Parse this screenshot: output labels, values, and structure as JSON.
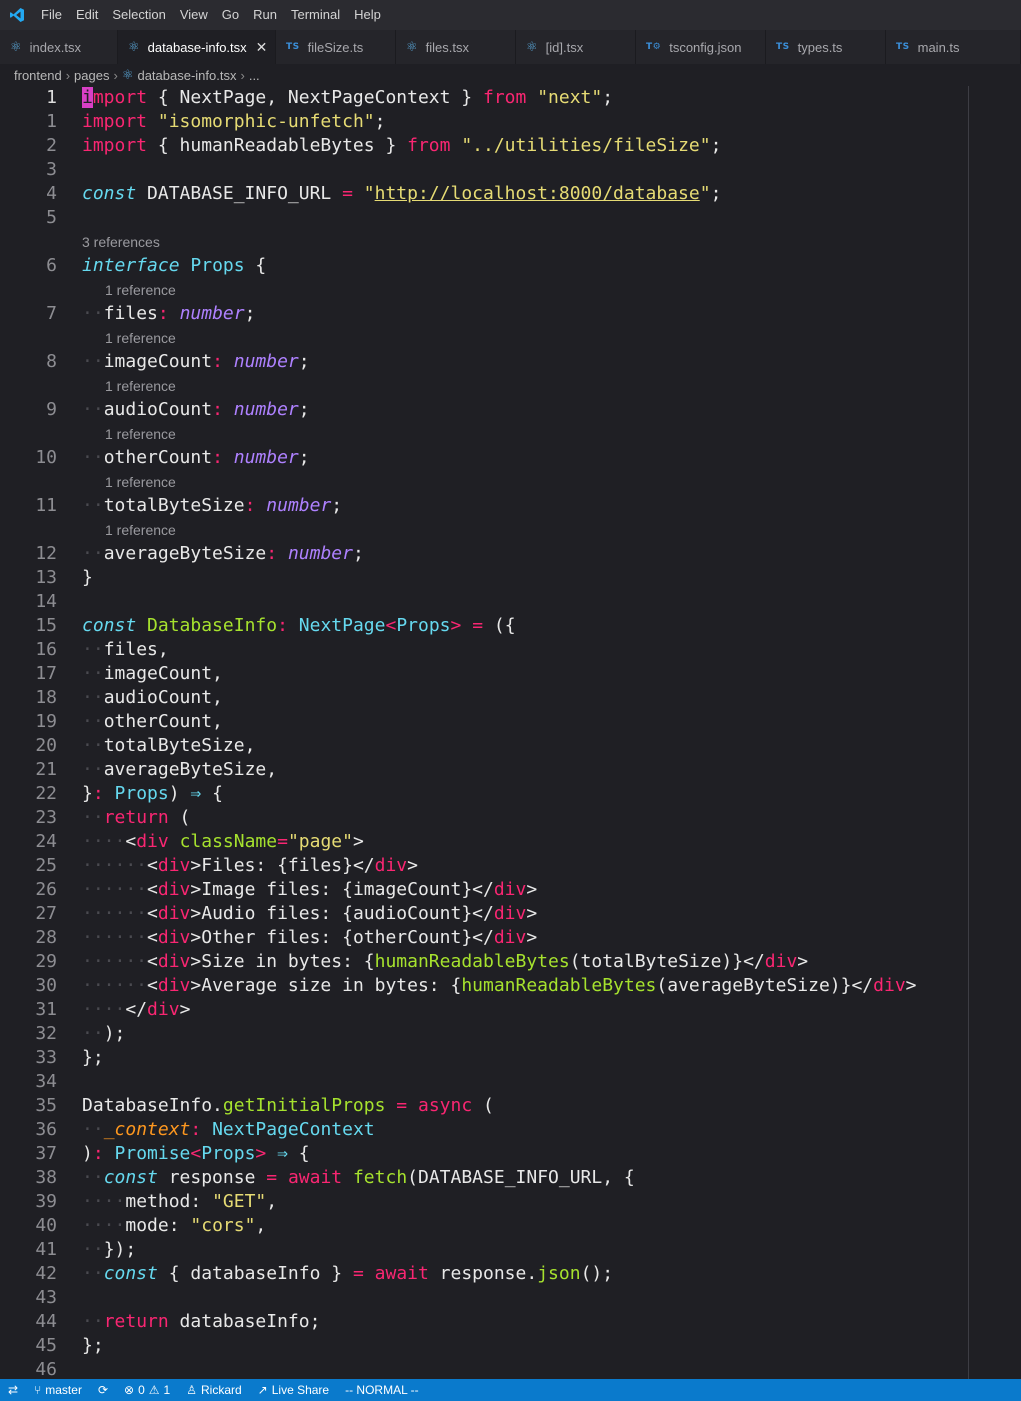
{
  "menu": [
    "File",
    "Edit",
    "Selection",
    "View",
    "Go",
    "Run",
    "Terminal",
    "Help"
  ],
  "tabs": [
    {
      "label": "index.tsx",
      "icon": "react-icon",
      "active": false
    },
    {
      "label": "database-info.tsx",
      "icon": "react-icon",
      "active": true
    },
    {
      "label": "fileSize.ts",
      "icon": "ts-icon",
      "active": false
    },
    {
      "label": "files.tsx",
      "icon": "react-icon",
      "active": false
    },
    {
      "label": "[id].tsx",
      "icon": "react-icon",
      "active": false
    },
    {
      "label": "tsconfig.json",
      "icon": "tsconfig-icon",
      "active": false
    },
    {
      "label": "types.ts",
      "icon": "ts-icon",
      "active": false
    },
    {
      "label": "main.ts",
      "icon": "ts-icon",
      "active": false
    }
  ],
  "tab_badges": {
    "ts": "TS",
    "tsconfig": "T⚙"
  },
  "breadcrumb": [
    "frontend",
    "pages",
    "database-info.tsx",
    "..."
  ],
  "editor": {
    "lines": [
      {
        "n": "1",
        "cur": true,
        "html": "<span class=\"cursor\">i</span><span class=\"t-kw\">mport</span><span class=\"t-pl\"> { NextPage, NextPageContext } </span><span class=\"t-kw\">from</span><span class=\"t-pl\"> </span><span class=\"t-st\">\"next\"</span><span class=\"t-pl\">;</span>"
      },
      {
        "n": "1",
        "html": "<span class=\"t-kw\">import</span><span class=\"t-pl\"> </span><span class=\"t-st\">\"isomorphic-unfetch\"</span><span class=\"t-pl\">;</span>"
      },
      {
        "n": "2",
        "html": "<span class=\"t-kw\">import</span><span class=\"t-pl\"> { humanReadableBytes } </span><span class=\"t-kw\">from</span><span class=\"t-pl\"> </span><span class=\"t-st\">\"../utilities/fileSize\"</span><span class=\"t-pl\">;</span>"
      },
      {
        "n": "3",
        "html": ""
      },
      {
        "n": "4",
        "html": "<span class=\"t-stor\">const</span><span class=\"t-pl\"> DATABASE_INFO_URL </span><span class=\"t-kw\">=</span><span class=\"t-pl\"> </span><span class=\"t-st\">\"</span><span class=\"t-url\">http://localhost:8000/database</span><span class=\"t-st\">\"</span><span class=\"t-pl\">;</span>"
      },
      {
        "n": "5",
        "html": ""
      },
      {
        "lens": "3 references",
        "indent": 0
      },
      {
        "n": "6",
        "html": "<span class=\"t-stor\">interface</span><span class=\"t-pl\"> </span><span class=\"t-cls\">Props</span><span class=\"t-pl\"> {</span>"
      },
      {
        "lens": "1 reference",
        "indent": 1
      },
      {
        "n": "7",
        "html": "<span class=\"t-ws\">··</span><span class=\"t-pl\">files</span><span class=\"t-kw\">:</span><span class=\"t-pl\"> </span><span class=\"t-type\">number</span><span class=\"t-pl\">;</span>"
      },
      {
        "lens": "1 reference",
        "indent": 1
      },
      {
        "n": "8",
        "html": "<span class=\"t-ws\">··</span><span class=\"t-pl\">imageCount</span><span class=\"t-kw\">:</span><span class=\"t-pl\"> </span><span class=\"t-type\">number</span><span class=\"t-pl\">;</span>"
      },
      {
        "lens": "1 reference",
        "indent": 1
      },
      {
        "n": "9",
        "html": "<span class=\"t-ws\">··</span><span class=\"t-pl\">audioCount</span><span class=\"t-kw\">:</span><span class=\"t-pl\"> </span><span class=\"t-type\">number</span><span class=\"t-pl\">;</span>"
      },
      {
        "lens": "1 reference",
        "indent": 1
      },
      {
        "n": "10",
        "html": "<span class=\"t-ws\">··</span><span class=\"t-pl\">otherCount</span><span class=\"t-kw\">:</span><span class=\"t-pl\"> </span><span class=\"t-type\">number</span><span class=\"t-pl\">;</span>"
      },
      {
        "lens": "1 reference",
        "indent": 1
      },
      {
        "n": "11",
        "html": "<span class=\"t-ws\">··</span><span class=\"t-pl\">totalByteSize</span><span class=\"t-kw\">:</span><span class=\"t-pl\"> </span><span class=\"t-type\">number</span><span class=\"t-pl\">;</span>"
      },
      {
        "lens": "1 reference",
        "indent": 1
      },
      {
        "n": "12",
        "html": "<span class=\"t-ws\">··</span><span class=\"t-pl\">averageByteSize</span><span class=\"t-kw\">:</span><span class=\"t-pl\"> </span><span class=\"t-type\">number</span><span class=\"t-pl\">;</span>"
      },
      {
        "n": "13",
        "html": "<span class=\"t-pl\">}</span>"
      },
      {
        "n": "14",
        "html": ""
      },
      {
        "n": "15",
        "html": "<span class=\"t-stor\">const</span><span class=\"t-pl\"> </span><span class=\"t-fn\">DatabaseInfo</span><span class=\"t-kw\">:</span><span class=\"t-pl\"> </span><span class=\"t-cls\">NextPage</span><span class=\"t-kw\">&lt;</span><span class=\"t-cls\">Props</span><span class=\"t-kw\">&gt;</span><span class=\"t-pl\"> </span><span class=\"t-kw\">=</span><span class=\"t-pl\"> ({</span>"
      },
      {
        "n": "16",
        "html": "<span class=\"t-ws\">··</span><span class=\"t-pl\">files,</span>"
      },
      {
        "n": "17",
        "html": "<span class=\"t-ws\">··</span><span class=\"t-pl\">imageCount,</span>"
      },
      {
        "n": "18",
        "html": "<span class=\"t-ws\">··</span><span class=\"t-pl\">audioCount,</span>"
      },
      {
        "n": "19",
        "html": "<span class=\"t-ws\">··</span><span class=\"t-pl\">otherCount,</span>"
      },
      {
        "n": "20",
        "html": "<span class=\"t-ws\">··</span><span class=\"t-pl\">totalByteSize,</span>"
      },
      {
        "n": "21",
        "html": "<span class=\"t-ws\">··</span><span class=\"t-pl\">averageByteSize,</span>"
      },
      {
        "n": "22",
        "html": "<span class=\"t-pl\">}</span><span class=\"t-kw\">:</span><span class=\"t-pl\"> </span><span class=\"t-cls\">Props</span><span class=\"t-pl\">) </span><span class=\"t-stor\">⇒</span><span class=\"t-pl\"> {</span>"
      },
      {
        "n": "23",
        "html": "<span class=\"t-ws\">··</span><span class=\"t-kw\">return</span><span class=\"t-pl\"> (</span>"
      },
      {
        "n": "24",
        "html": "<span class=\"t-ws\">····</span><span class=\"t-pl\">&lt;</span><span class=\"t-tag\">div</span><span class=\"t-pl\"> </span><span class=\"t-attr\">className</span><span class=\"t-kw\">=</span><span class=\"t-st\">\"page\"</span><span class=\"t-pl\">&gt;</span>"
      },
      {
        "n": "25",
        "html": "<span class=\"t-ws\">······</span><span class=\"t-pl\">&lt;</span><span class=\"t-tag\">div</span><span class=\"t-pl\">&gt;Files: {files}&lt;/</span><span class=\"t-tag\">div</span><span class=\"t-pl\">&gt;</span>"
      },
      {
        "n": "26",
        "html": "<span class=\"t-ws\">······</span><span class=\"t-pl\">&lt;</span><span class=\"t-tag\">div</span><span class=\"t-pl\">&gt;Image files: {imageCount}&lt;/</span><span class=\"t-tag\">div</span><span class=\"t-pl\">&gt;</span>"
      },
      {
        "n": "27",
        "html": "<span class=\"t-ws\">······</span><span class=\"t-pl\">&lt;</span><span class=\"t-tag\">div</span><span class=\"t-pl\">&gt;Audio files: {audioCount}&lt;/</span><span class=\"t-tag\">div</span><span class=\"t-pl\">&gt;</span>"
      },
      {
        "n": "28",
        "html": "<span class=\"t-ws\">······</span><span class=\"t-pl\">&lt;</span><span class=\"t-tag\">div</span><span class=\"t-pl\">&gt;Other files: {otherCount}&lt;/</span><span class=\"t-tag\">div</span><span class=\"t-pl\">&gt;</span>"
      },
      {
        "n": "29",
        "html": "<span class=\"t-ws\">······</span><span class=\"t-pl\">&lt;</span><span class=\"t-tag\">div</span><span class=\"t-pl\">&gt;Size in bytes: {</span><span class=\"t-fn\">humanReadableBytes</span><span class=\"t-pl\">(totalByteSize)}&lt;/</span><span class=\"t-tag\">div</span><span class=\"t-pl\">&gt;</span>"
      },
      {
        "n": "30",
        "html": "<span class=\"t-ws\">······</span><span class=\"t-pl\">&lt;</span><span class=\"t-tag\">div</span><span class=\"t-pl\">&gt;Average size in bytes: {</span><span class=\"t-fn\">humanReadableBytes</span><span class=\"t-pl\">(averageByteSize)}&lt;/</span><span class=\"t-tag\">div</span><span class=\"t-pl\">&gt;</span>"
      },
      {
        "n": "31",
        "html": "<span class=\"t-ws\">····</span><span class=\"t-pl\">&lt;/</span><span class=\"t-tag\">div</span><span class=\"t-pl\">&gt;</span>"
      },
      {
        "n": "32",
        "html": "<span class=\"t-ws\">··</span><span class=\"t-pl\">);</span>"
      },
      {
        "n": "33",
        "html": "<span class=\"t-pl\">};</span>"
      },
      {
        "n": "34",
        "html": ""
      },
      {
        "n": "35",
        "html": "<span class=\"t-pl\">DatabaseInfo.</span><span class=\"t-fn\">getInitialProps</span><span class=\"t-pl\"> </span><span class=\"t-kw\">=</span><span class=\"t-pl\"> </span><span class=\"t-kw\">async</span><span class=\"t-pl\"> (</span>"
      },
      {
        "n": "36",
        "html": "<span class=\"t-ws\">··</span><span class=\"t-var\">_context</span><span class=\"t-kw\">:</span><span class=\"t-pl\"> </span><span class=\"t-cls\">NextPageContext</span>"
      },
      {
        "n": "37",
        "html": "<span class=\"t-pl\">)</span><span class=\"t-kw\">:</span><span class=\"t-pl\"> </span><span class=\"t-cls\">Promise</span><span class=\"t-kw\">&lt;</span><span class=\"t-cls\">Props</span><span class=\"t-kw\">&gt;</span><span class=\"t-pl\"> </span><span class=\"t-stor\">⇒</span><span class=\"t-pl\"> {</span>"
      },
      {
        "n": "38",
        "html": "<span class=\"t-ws\">··</span><span class=\"t-stor\">const</span><span class=\"t-pl\"> response </span><span class=\"t-kw\">=</span><span class=\"t-pl\"> </span><span class=\"t-kw\">await</span><span class=\"t-pl\"> </span><span class=\"t-fn\">fetch</span><span class=\"t-pl\">(DATABASE_INFO_URL, {</span>"
      },
      {
        "n": "39",
        "html": "<span class=\"t-ws\">····</span><span class=\"t-pl\">method: </span><span class=\"t-st\">\"GET\"</span><span class=\"t-pl\">,</span>"
      },
      {
        "n": "40",
        "html": "<span class=\"t-ws\">····</span><span class=\"t-pl\">mode: </span><span class=\"t-st\">\"cors\"</span><span class=\"t-pl\">,</span>"
      },
      {
        "n": "41",
        "html": "<span class=\"t-ws\">··</span><span class=\"t-pl\">});</span>"
      },
      {
        "n": "42",
        "html": "<span class=\"t-ws\">··</span><span class=\"t-stor\">const</span><span class=\"t-pl\"> { databaseInfo } </span><span class=\"t-kw\">=</span><span class=\"t-pl\"> </span><span class=\"t-kw\">await</span><span class=\"t-pl\"> response.</span><span class=\"t-fn\">json</span><span class=\"t-pl\">();</span>"
      },
      {
        "n": "43",
        "html": ""
      },
      {
        "n": "44",
        "html": "<span class=\"t-ws\">··</span><span class=\"t-kw\">return</span><span class=\"t-pl\"> databaseInfo;</span>"
      },
      {
        "n": "45",
        "html": "<span class=\"t-pl\">};</span>"
      },
      {
        "n": "46",
        "html": ""
      }
    ]
  },
  "statusbar": {
    "remote_icon": "⇄",
    "branch": "master",
    "sync_icon": "⟳",
    "errors": "0",
    "warnings": "1",
    "user": "Rickard",
    "live_share": "Live Share",
    "mode": "-- NORMAL --"
  },
  "colors": {
    "accent": "#0a7acc",
    "editor_bg": "#1f1f24",
    "keyword": "#f92672",
    "string": "#e6db74"
  }
}
